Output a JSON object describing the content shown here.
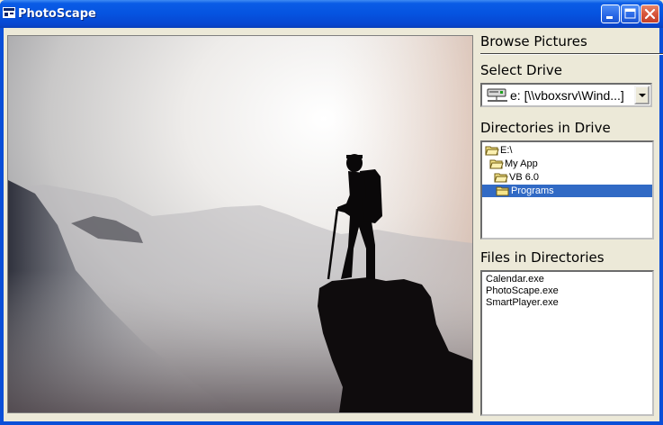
{
  "window": {
    "title": "PhotoScape"
  },
  "panel": {
    "browse_label": "Browse Pictures",
    "select_drive_label": "Select Drive",
    "drive_value": "e: [\\\\vboxsrv\\Wind...]",
    "directories_label": "Directories in Drive",
    "files_label": "Files in Directories"
  },
  "directories": [
    {
      "label": "E:\\"
    },
    {
      "label": "My App"
    },
    {
      "label": "VB 6.0"
    },
    {
      "label": "Programs"
    }
  ],
  "files": [
    {
      "label": "Calendar.exe"
    },
    {
      "label": "PhotoScape.exe"
    },
    {
      "label": "SmartPlayer.exe"
    }
  ],
  "icons": {
    "app": "photoscape-app-icon",
    "minimize": "minimize-icon",
    "maximize": "maximize-icon",
    "close": "close-icon",
    "drive": "network-drive-icon",
    "folder": "folder-icon",
    "open_folder": "open-folder-icon",
    "dropdown": "chevron-down-icon"
  },
  "colors": {
    "titlebar": "#0553e0",
    "selection": "#316ac5",
    "close_button": "#d7553a",
    "dialog_background": "#ece9d8"
  }
}
